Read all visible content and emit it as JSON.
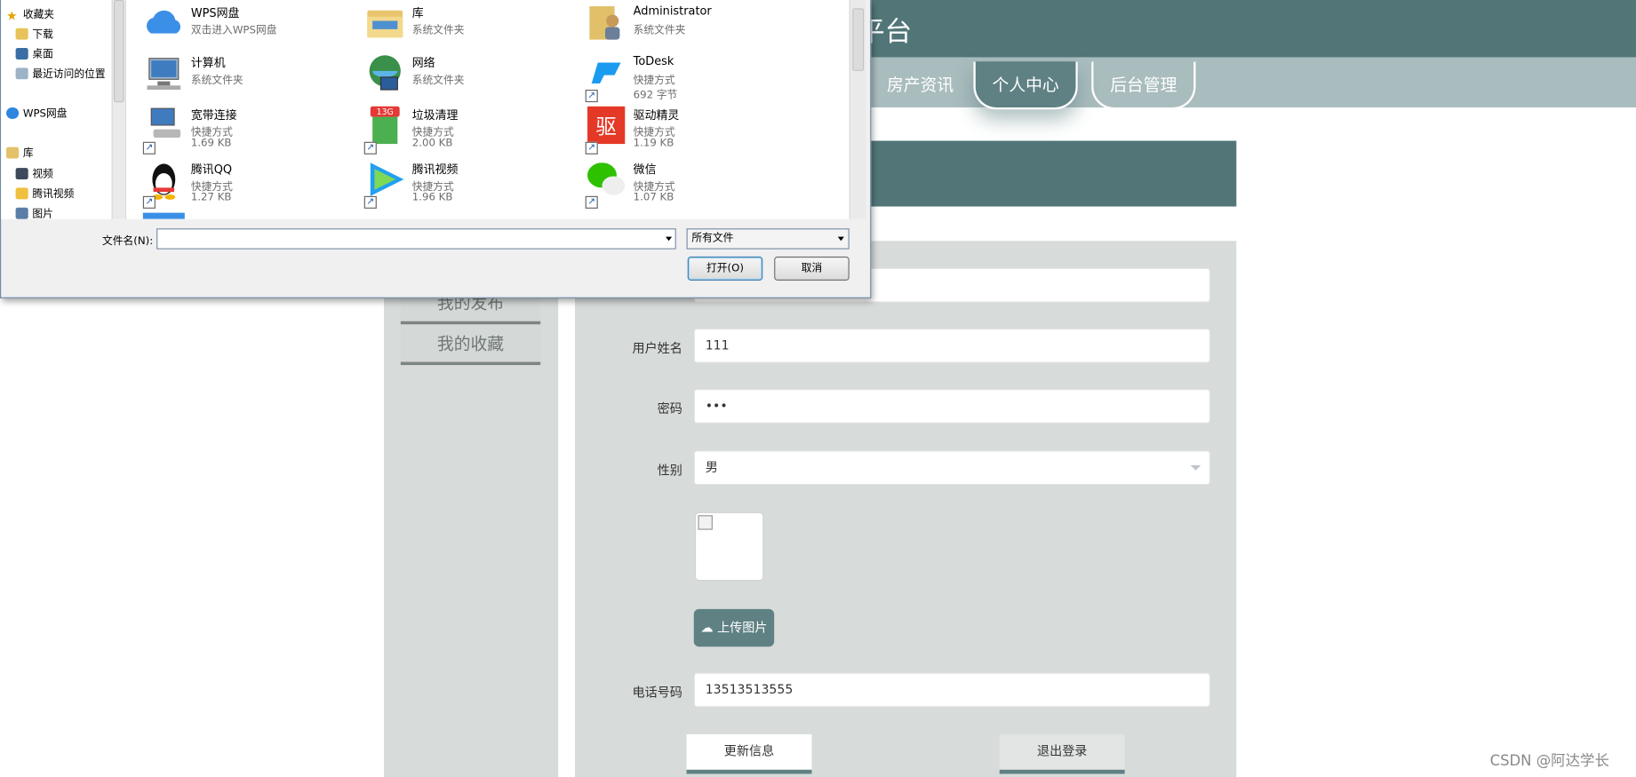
{
  "header": {
    "brand_fragment": "平台"
  },
  "nav": {
    "tabs": [
      {
        "label": "房产资讯"
      },
      {
        "label": "个人中心"
      },
      {
        "label": "后台管理"
      }
    ]
  },
  "section_title": "",
  "side_menu": {
    "items": [
      {
        "label": "我的发布"
      },
      {
        "label": "我的收藏"
      }
    ]
  },
  "form": {
    "name_label": "用户姓名",
    "name_value": "111",
    "password_label": "密码",
    "password_value": "•••",
    "gender_label": "性别",
    "gender_value": "男",
    "upload_label": "上传图片",
    "phone_label": "电话号码",
    "phone_value": "13513513555",
    "update_button": "更新信息",
    "logout_button": "退出登录"
  },
  "dialog": {
    "nav": [
      {
        "label": "收藏夹",
        "icon": "star-icon"
      },
      {
        "label": "下载",
        "icon": "download-icon"
      },
      {
        "label": "桌面",
        "icon": "desktop-icon"
      },
      {
        "label": "最近访问的位置",
        "icon": "recent-icon"
      },
      {
        "label": "WPS网盘",
        "icon": "cloud-icon"
      },
      {
        "label": "库",
        "icon": "library-icon"
      },
      {
        "label": "视频",
        "icon": "video-icon"
      },
      {
        "label": "腾讯视频",
        "icon": "folder-icon"
      },
      {
        "label": "图片",
        "icon": "picture-icon"
      }
    ],
    "files": [
      {
        "name": "WPS网盘",
        "line1": "双击进入WPS网盘",
        "line2": "",
        "icon": "cloud-icon"
      },
      {
        "name": "库",
        "line1": "系统文件夹",
        "line2": "",
        "icon": "library-icon"
      },
      {
        "name": "Administrator",
        "line1": "系统文件夹",
        "line2": "",
        "icon": "user-folder-icon"
      },
      {
        "name": "计算机",
        "line1": "系统文件夹",
        "line2": "",
        "icon": "computer-icon"
      },
      {
        "name": "网络",
        "line1": "系统文件夹",
        "line2": "",
        "icon": "network-icon"
      },
      {
        "name": "ToDesk",
        "line1": "快捷方式",
        "line2": "692 字节",
        "icon": "todesk-icon"
      },
      {
        "name": "宽带连接",
        "line1": "快捷方式",
        "line2": "1.69 KB",
        "icon": "broadband-icon"
      },
      {
        "name": "垃圾清理",
        "line1": "快捷方式",
        "line2": "2.00 KB",
        "icon": "cleaner-icon"
      },
      {
        "name": "驱动精灵",
        "line1": "快捷方式",
        "line2": "1.19 KB",
        "icon": "driver-icon"
      },
      {
        "name": "腾讯QQ",
        "line1": "快捷方式",
        "line2": "1.27 KB",
        "icon": "qq-icon"
      },
      {
        "name": "腾讯视频",
        "line1": "快捷方式",
        "line2": "1.96 KB",
        "icon": "tencent-video-icon"
      },
      {
        "name": "微信",
        "line1": "快捷方式",
        "line2": "1.07 KB",
        "icon": "wechat-icon"
      }
    ],
    "filename_label": "文件名(N):",
    "filename_value": "",
    "filetype_value": "所有文件",
    "open_button": "打开(O)",
    "cancel_button": "取消",
    "badge_13g": "13G",
    "driver_glyph": "驱"
  },
  "watermark": "CSDN @阿达学长",
  "colors": {
    "primary": "#527678",
    "nav_bg": "#a9bcbe",
    "panel_bg": "#d7dbd9"
  }
}
